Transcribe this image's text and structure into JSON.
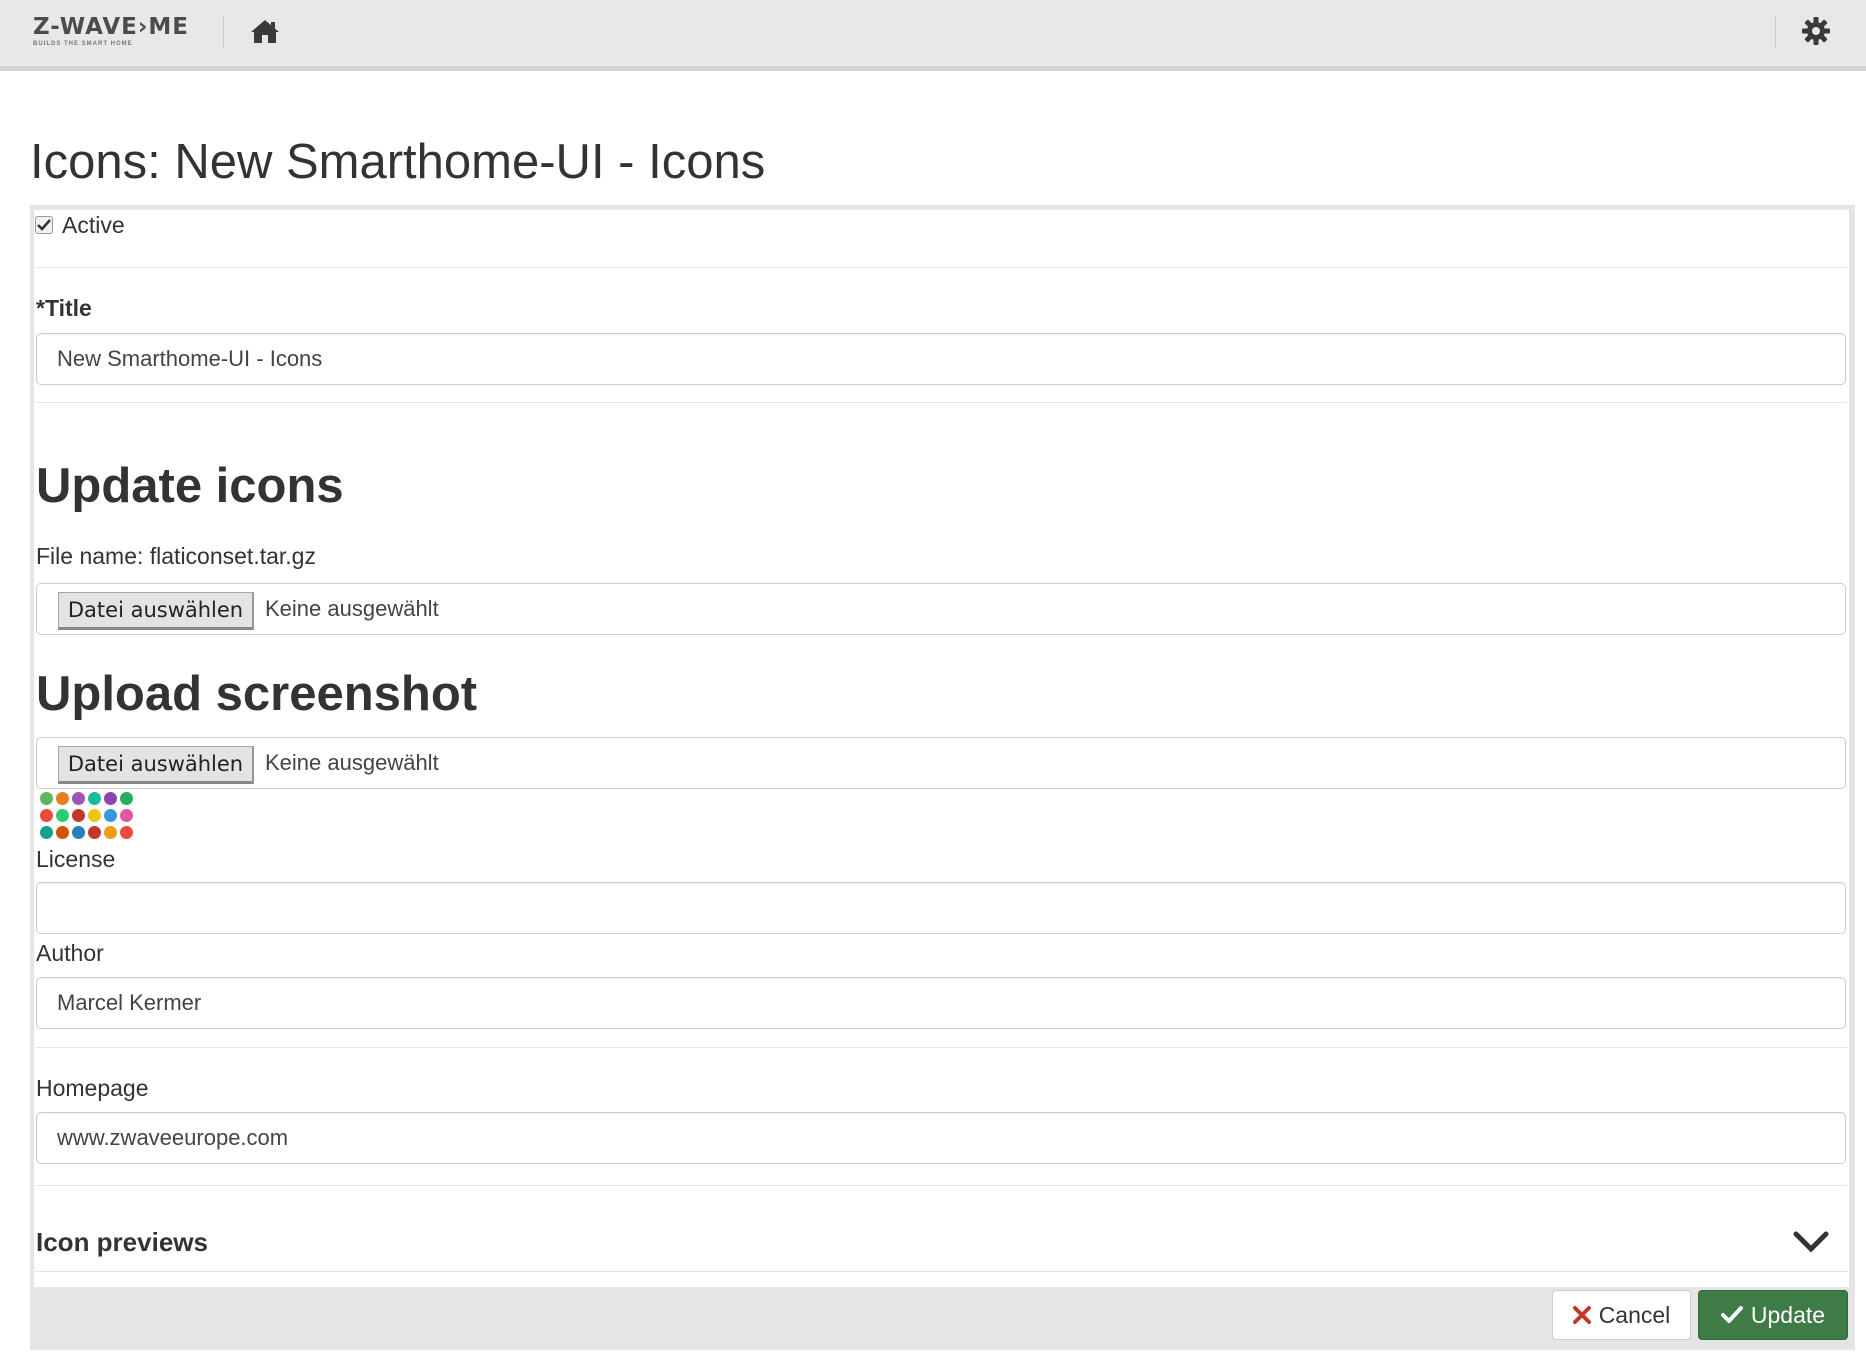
{
  "header": {
    "logo_main": "Z-WAVE›ME",
    "logo_sub": "BUILDS THE SMART HOME",
    "home_icon": "home-icon",
    "settings_icon": "gear-icon"
  },
  "page": {
    "title": "Icons: New Smarthome-UI - Icons"
  },
  "form": {
    "active_label": "Active",
    "active_checked": true,
    "title_label": "*Title",
    "title_value": "New Smarthome-UI - Icons",
    "update_heading": "Update icons",
    "file_name_label": "File name: flaticonset.tar.gz",
    "file_button_label": "Datei auswählen",
    "file_none_text": "Keine ausgewählt",
    "upload_heading": "Upload screenshot",
    "screenshot_button_label": "Datei auswählen",
    "screenshot_none_text": "Keine ausgewählt",
    "license_label": "License",
    "license_value": "",
    "author_label": "Author",
    "author_value": "Marcel Kermer",
    "homepage_label": "Homepage",
    "homepage_value": "www.zwaveeurope.com",
    "previews_label": "Icon previews"
  },
  "actions": {
    "cancel_label": "Cancel",
    "update_label": "Update"
  },
  "colors": {
    "update_green": "#3f7b47",
    "cancel_red": "#c0392b"
  }
}
